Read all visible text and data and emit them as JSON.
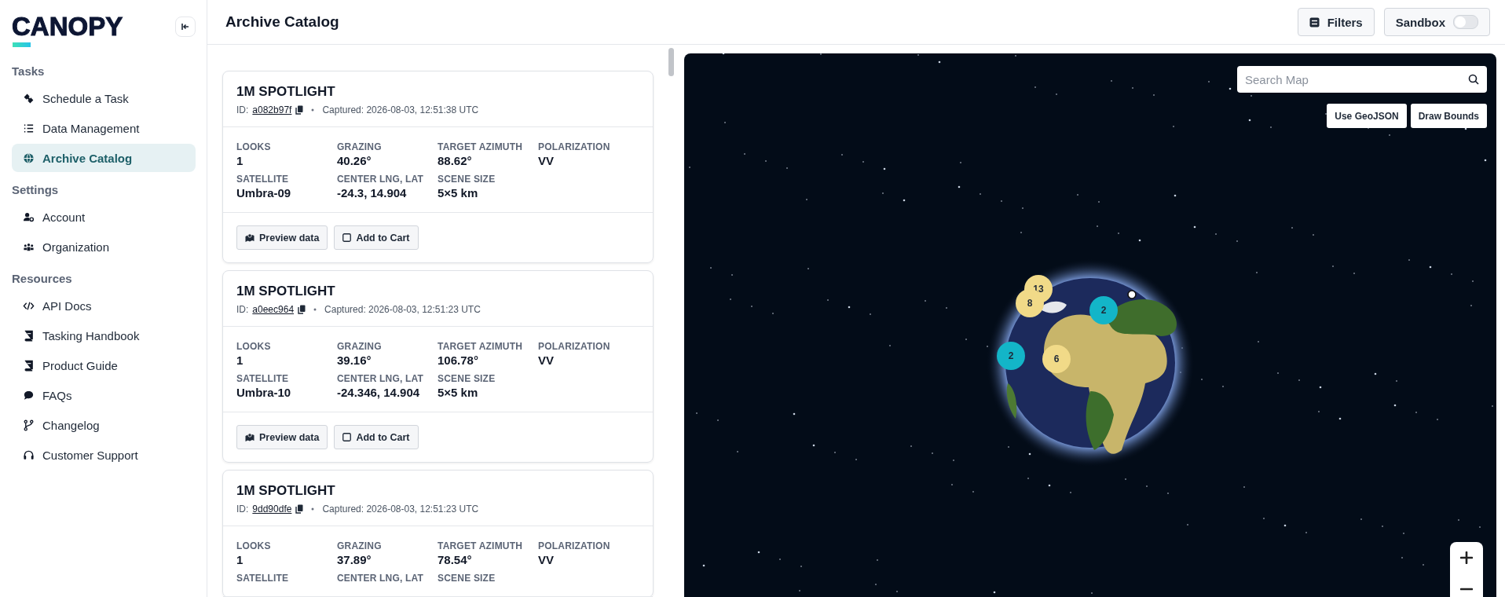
{
  "brand": {
    "name": "CANOPY"
  },
  "sidebar": {
    "sections": [
      {
        "title": "Tasks",
        "items": [
          {
            "label": "Schedule a Task",
            "selected": false
          },
          {
            "label": "Data Management",
            "selected": false
          },
          {
            "label": "Archive Catalog",
            "selected": true
          }
        ]
      },
      {
        "title": "Settings",
        "items": [
          {
            "label": "Account",
            "selected": false
          },
          {
            "label": "Organization",
            "selected": false
          }
        ]
      },
      {
        "title": "Resources",
        "items": [
          {
            "label": "API Docs",
            "selected": false
          },
          {
            "label": "Tasking Handbook",
            "selected": false
          },
          {
            "label": "Product Guide",
            "selected": false
          },
          {
            "label": "FAQs",
            "selected": false
          },
          {
            "label": "Changelog",
            "selected": false
          },
          {
            "label": "Customer Support",
            "selected": false
          }
        ]
      }
    ]
  },
  "header": {
    "title": "Archive Catalog",
    "filters_button": "Filters",
    "sandbox": {
      "label": "Sandbox",
      "on": false
    }
  },
  "results": [
    {
      "title": "1M SPOTLIGHT",
      "id_label": "ID:",
      "id": "a082b97f",
      "captured": "Captured: 2026-08-03, 12:51:38 UTC",
      "fields": [
        {
          "label": "LOOKS",
          "value": "1"
        },
        {
          "label": "GRAZING",
          "value": "40.26°"
        },
        {
          "label": "TARGET AZIMUTH",
          "value": "88.62°"
        },
        {
          "label": "POLARIZATION",
          "value": "VV"
        },
        {
          "label": "SATELLITE",
          "value": "Umbra-09"
        },
        {
          "label": "CENTER LNG, LAT",
          "value": "-24.3, 14.904"
        },
        {
          "label": "SCENE SIZE",
          "value": "5×5 km"
        }
      ],
      "actions": [
        "Preview data",
        "Add to Cart"
      ]
    },
    {
      "title": "1M SPOTLIGHT",
      "id_label": "ID:",
      "id": "a0eec964",
      "captured": "Captured: 2026-08-03, 12:51:23 UTC",
      "fields": [
        {
          "label": "LOOKS",
          "value": "1"
        },
        {
          "label": "GRAZING",
          "value": "39.16°"
        },
        {
          "label": "TARGET AZIMUTH",
          "value": "106.78°"
        },
        {
          "label": "POLARIZATION",
          "value": "VV"
        },
        {
          "label": "SATELLITE",
          "value": "Umbra-10"
        },
        {
          "label": "CENTER LNG, LAT",
          "value": "-24.346, 14.904"
        },
        {
          "label": "SCENE SIZE",
          "value": "5×5 km"
        }
      ],
      "actions": [
        "Preview data",
        "Add to Cart"
      ]
    },
    {
      "title": "1M SPOTLIGHT",
      "id_label": "ID:",
      "id": "9dd90dfe",
      "captured": "Captured: 2026-08-03, 12:51:23 UTC",
      "fields": [
        {
          "label": "LOOKS",
          "value": "1"
        },
        {
          "label": "GRAZING",
          "value": "37.89°"
        },
        {
          "label": "TARGET AZIMUTH",
          "value": "78.54°"
        },
        {
          "label": "POLARIZATION",
          "value": "VV"
        },
        {
          "label": "SATELLITE"
        },
        {
          "label": "CENTER LNG, LAT"
        },
        {
          "label": "SCENE SIZE"
        }
      ]
    }
  ],
  "map": {
    "search": {
      "placeholder": "Search Map"
    },
    "buttons": [
      "Use GeoJSON",
      "Draw Bounds"
    ],
    "clusters": [
      {
        "count": "13",
        "color": "#f1da88"
      },
      {
        "count": "8",
        "color": "#f1da88"
      },
      {
        "count": "2",
        "color": "#13b5c8"
      },
      {
        "count": "2",
        "color": "#13b5c8"
      },
      {
        "count": "6",
        "color": "#f1da88"
      }
    ]
  }
}
